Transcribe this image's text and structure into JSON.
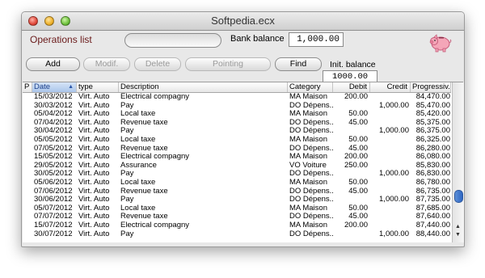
{
  "window": {
    "title": "Softpedia.ecx"
  },
  "header": {
    "operations_label": "Operations list",
    "bank_balance_label": "Bank balance",
    "bank_balance_value": "1,000.00",
    "init_balance_label": "Init. balance",
    "init_balance_value": "1000.00"
  },
  "toolbar": {
    "add": "Add",
    "modif": "Modif.",
    "delete": "Delete",
    "pointing": "Pointing",
    "find": "Find"
  },
  "table": {
    "headers": {
      "p": "P",
      "date": "Date",
      "type": "type",
      "description": "Description",
      "category": "Category",
      "debit": "Debit",
      "credit": "Credit",
      "progressive": "Progressiv..."
    },
    "rows": [
      {
        "date": "15/03/2012",
        "type": "Virt. Auto",
        "description": "Electrical compagny",
        "category": "MA Maison",
        "debit": "200.00",
        "credit": "",
        "progressive": "84,470.00"
      },
      {
        "date": "30/03/2012",
        "type": "Virt. Auto",
        "description": "Pay",
        "category": "DO Dépens...",
        "debit": "",
        "credit": "1,000.00",
        "progressive": "85,470.00"
      },
      {
        "date": "05/04/2012",
        "type": "Virt. Auto",
        "description": "Local taxe",
        "category": "MA Maison",
        "debit": "50.00",
        "credit": "",
        "progressive": "85,420.00"
      },
      {
        "date": "07/04/2012",
        "type": "Virt. Auto",
        "description": "Revenue taxe",
        "category": "DO Dépens...",
        "debit": "45.00",
        "credit": "",
        "progressive": "85,375.00"
      },
      {
        "date": "30/04/2012",
        "type": "Virt. Auto",
        "description": "Pay",
        "category": "DO Dépens...",
        "debit": "",
        "credit": "1,000.00",
        "progressive": "86,375.00"
      },
      {
        "date": "05/05/2012",
        "type": "Virt. Auto",
        "description": "Local taxe",
        "category": "MA Maison",
        "debit": "50.00",
        "credit": "",
        "progressive": "86,325.00"
      },
      {
        "date": "07/05/2012",
        "type": "Virt. Auto",
        "description": "Revenue taxe",
        "category": "DO Dépens...",
        "debit": "45.00",
        "credit": "",
        "progressive": "86,280.00"
      },
      {
        "date": "15/05/2012",
        "type": "Virt. Auto",
        "description": "Electrical compagny",
        "category": "MA Maison",
        "debit": "200.00",
        "credit": "",
        "progressive": "86,080.00"
      },
      {
        "date": "29/05/2012",
        "type": "Virt. Auto",
        "description": "Assurance",
        "category": "VO Voiture",
        "debit": "250.00",
        "credit": "",
        "progressive": "85,830.00"
      },
      {
        "date": "30/05/2012",
        "type": "Virt. Auto",
        "description": "Pay",
        "category": "DO Dépens...",
        "debit": "",
        "credit": "1,000.00",
        "progressive": "86,830.00"
      },
      {
        "date": "05/06/2012",
        "type": "Virt. Auto",
        "description": "Local taxe",
        "category": "MA Maison",
        "debit": "50.00",
        "credit": "",
        "progressive": "86,780.00"
      },
      {
        "date": "07/06/2012",
        "type": "Virt. Auto",
        "description": "Revenue taxe",
        "category": "DO Dépens...",
        "debit": "45.00",
        "credit": "",
        "progressive": "86,735.00"
      },
      {
        "date": "30/06/2012",
        "type": "Virt. Auto",
        "description": "Pay",
        "category": "DO Dépens...",
        "debit": "",
        "credit": "1,000.00",
        "progressive": "87,735.00"
      },
      {
        "date": "05/07/2012",
        "type": "Virt. Auto",
        "description": "Local taxe",
        "category": "MA Maison",
        "debit": "50.00",
        "credit": "",
        "progressive": "87,685.00"
      },
      {
        "date": "07/07/2012",
        "type": "Virt. Auto",
        "description": "Revenue taxe",
        "category": "DO Dépens...",
        "debit": "45.00",
        "credit": "",
        "progressive": "87,640.00"
      },
      {
        "date": "15/07/2012",
        "type": "Virt. Auto",
        "description": "Electrical compagny",
        "category": "MA Maison",
        "debit": "200.00",
        "credit": "",
        "progressive": "87,440.00"
      },
      {
        "date": "30/07/2012",
        "type": "Virt. Auto",
        "description": "Pay",
        "category": "DO Dépens...",
        "debit": "",
        "credit": "1,000.00",
        "progressive": "88,440.00"
      }
    ]
  },
  "scrollbar": {
    "position": 0.85
  },
  "icons": {
    "piggy_bank": "pig-icon",
    "sort": "sort-ascending-icon",
    "scroll_up": "scroll-up-arrow-icon",
    "scroll_down": "scroll-down-arrow-icon"
  }
}
